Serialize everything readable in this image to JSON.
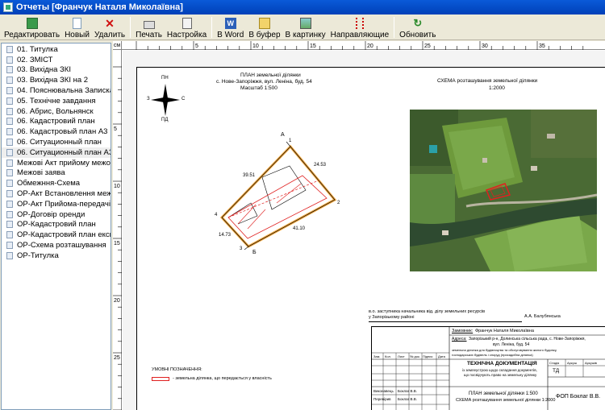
{
  "window": {
    "title": "Отчеты  [Франчук Наталя Миколаївна]"
  },
  "toolbar": {
    "buttons": [
      {
        "label": "Редактировать",
        "icon": "edit-icon"
      },
      {
        "label": "Новый",
        "icon": "new-document-icon"
      },
      {
        "label": "Удалить",
        "icon": "delete-icon"
      },
      {
        "label": "Печать",
        "icon": "printer-icon"
      },
      {
        "label": "Настройка",
        "icon": "settings-icon"
      },
      {
        "label": "В Word",
        "icon": "word-icon"
      },
      {
        "label": "В буфер",
        "icon": "clipboard-icon"
      },
      {
        "label": "В картинку",
        "icon": "picture-icon"
      },
      {
        "label": "Направляющие",
        "icon": "guides-icon"
      },
      {
        "label": "Обновить",
        "icon": "refresh-icon"
      }
    ]
  },
  "sidebar": {
    "items": [
      "01. Титулка",
      "02. ЗМІСТ",
      "03. Вихідна ЗКІ",
      "03. Вихідна ЗКІ на 2",
      "04. Пояснювальна Записка",
      "05. Технічне завдання",
      "06. Абрис, Вольнянск",
      "06. Кадастровий план",
      "06. Кадастровый план А3",
      "06. Ситуационный план",
      "06. Ситуационный план А3",
      "Межові  Акт прийому межових з",
      "Межові  заява",
      "Обмежння-Схема",
      "ОР-Акт Встановлення меж",
      "ОР-Акт Прийома-передачі",
      "ОР-Договір оренди",
      "ОР-Кадастровий план",
      "ОР-Кадастровий план експл",
      "ОР-Схема розташування",
      "ОР-Титулка"
    ],
    "selected_index": 10
  },
  "ruler": {
    "unit": "см",
    "h_labels": [
      "5",
      "10",
      "15",
      "20",
      "25",
      "30",
      "35"
    ],
    "v_labels": [
      "5",
      "10",
      "15",
      "20",
      "25"
    ]
  },
  "sheet": {
    "plan_title": "ПЛАН земельної ділянки",
    "plan_address": "с. Нове-Запоріжжя, вул. Леніна, буд. 54",
    "plan_scale": "Масштаб 1:500",
    "scheme_title": "СХЕМА розташування земельної ділянки",
    "scheme_scale": "1:2000",
    "compass": {
      "n": "ПН",
      "s": "ПД",
      "w": "З",
      "e": "С"
    },
    "points": {
      "a": "А",
      "b": "Б",
      "p1": "1",
      "p2": "2",
      "p3": "3",
      "p4": "4"
    },
    "dims": {
      "d1": "39.51",
      "d2": "24.53",
      "d3": "41.10",
      "d4": "14.73"
    },
    "signature_line1": "в.о. заступника начальника від. ділу земельних ресурсів",
    "signature_line2": "у Запорізькому районі",
    "signer": "А.А. Балубянська",
    "legend_title": "УМОВНІ ПОЗНАЧЕННЯ:",
    "legend_item": "- земельна ділянка, що передається у власність",
    "stamp": {
      "customer_label": "Замовник:",
      "customer": "Франчук Наталя Миколаївна",
      "address_label": "Адреса:",
      "address1": "Запорізький р-н, Долинська сільська рада, с. Нове-Запоріжжя,",
      "address2": "вул. Леніна, буд. 54",
      "purpose1": "земельна ділянка для будівництва та обслуговування жилого будинку,",
      "purpose2": "господарських будівель і споруд (присадибна ділянка)",
      "headers": [
        "Зам.",
        "Кол.",
        "Лист",
        "№ док.",
        "Підпис",
        "Дата"
      ],
      "doc_title": "ТЕХНІЧНА ДОКУМЕНТАЦІЯ",
      "doc_sub1": "із землеустрою щодо складання документів,",
      "doc_sub2": "що посвідчують право на земельну ділянку",
      "stage_h": "Стадія",
      "sheet_h": "Аркуш",
      "sheets_h": "Аркушів",
      "stage": "ТД",
      "role1": "Виконавець",
      "name1": "Боклаг В.В.",
      "role2": "Перевірив",
      "name2": "Боклаг В.В.",
      "plan_line": "ПЛАН земельної ділянки 1:500",
      "scheme_line": "СХЕМА розташування земельної ділянки 1:2000",
      "firm": "ФОП Боклаг В.В."
    }
  }
}
